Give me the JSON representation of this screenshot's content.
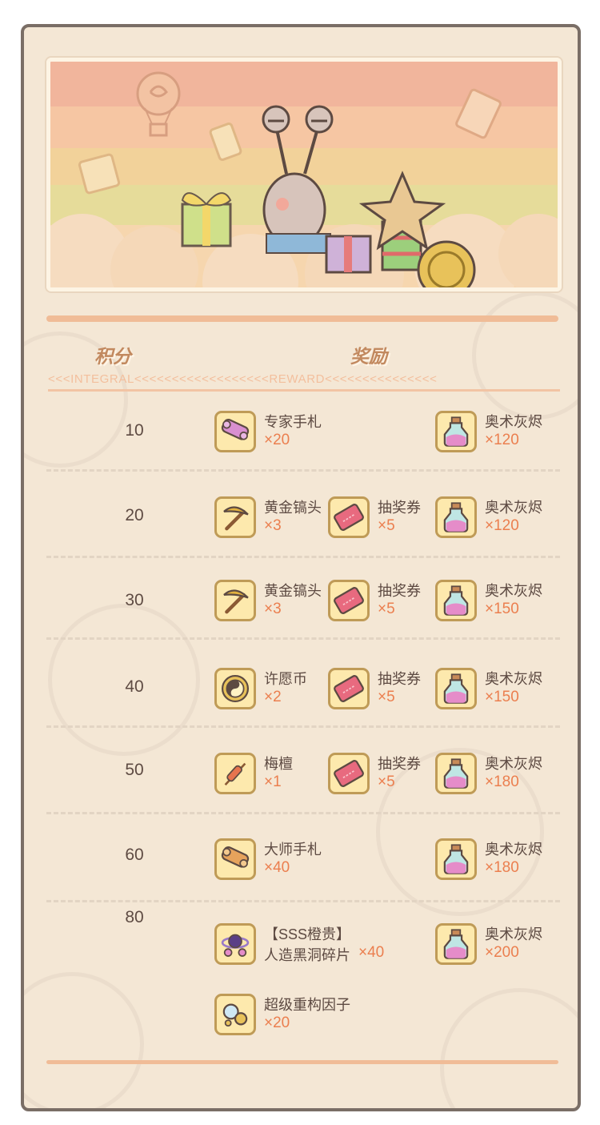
{
  "headers": {
    "score_label": "积分",
    "reward_label": "奖励",
    "decor_line": "<<<INTEGRAL<<<<<<<<<<<<<<<<<<REWARD<<<<<<<<<<<<<<<"
  },
  "rows": [
    {
      "score": "10",
      "rewards": [
        {
          "name": "专家手札",
          "qty": "×20",
          "icon": "scroll-icon"
        },
        {
          "name": "奥术灰烬",
          "qty": "×120",
          "icon": "potion-bottle-icon"
        }
      ]
    },
    {
      "score": "20",
      "rewards": [
        {
          "name": "黄金镐头",
          "qty": "×3",
          "icon": "pickaxe-icon"
        },
        {
          "name": "抽奖券",
          "qty": "×5",
          "icon": "ticket-icon"
        },
        {
          "name": "奥术灰烬",
          "qty": "×120",
          "icon": "potion-bottle-icon"
        }
      ]
    },
    {
      "score": "30",
      "rewards": [
        {
          "name": "黄金镐头",
          "qty": "×3",
          "icon": "pickaxe-icon"
        },
        {
          "name": "抽奖券",
          "qty": "×5",
          "icon": "ticket-icon"
        },
        {
          "name": "奥术灰烬",
          "qty": "×150",
          "icon": "potion-bottle-icon"
        }
      ]
    },
    {
      "score": "40",
      "rewards": [
        {
          "name": "许愿币",
          "qty": "×2",
          "icon": "coin-icon"
        },
        {
          "name": "抽奖券",
          "qty": "×5",
          "icon": "ticket-icon"
        },
        {
          "name": "奥术灰烬",
          "qty": "×150",
          "icon": "potion-bottle-icon"
        }
      ]
    },
    {
      "score": "50",
      "rewards": [
        {
          "name": "梅檀",
          "qty": "×1",
          "icon": "incense-stick-icon"
        },
        {
          "name": "抽奖券",
          "qty": "×5",
          "icon": "ticket-icon"
        },
        {
          "name": "奥术灰烬",
          "qty": "×180",
          "icon": "potion-bottle-icon"
        }
      ]
    },
    {
      "score": "60",
      "rewards": [
        {
          "name": "大师手札",
          "qty": "×40",
          "icon": "scroll-icon"
        },
        {
          "name": "奥术灰烬",
          "qty": "×180",
          "icon": "potion-bottle-icon"
        }
      ]
    },
    {
      "score": "80",
      "rewards": [
        {
          "name": "【SSS橙贵】",
          "name2": "人造黑洞碎片",
          "qty": "×40",
          "icon": "black-hole-icon"
        },
        {
          "name": "奥术灰烬",
          "qty": "×200",
          "icon": "potion-bottle-icon"
        },
        {
          "name": "超级重构因子",
          "qty": "×20",
          "icon": "factor-orb-icon"
        }
      ]
    }
  ],
  "colors": {
    "frame_bg": "#f4e7d5",
    "qty_orange": "#eb7f4f",
    "heading_tan": "#c2895f",
    "icon_bg": "#fde9ad"
  }
}
